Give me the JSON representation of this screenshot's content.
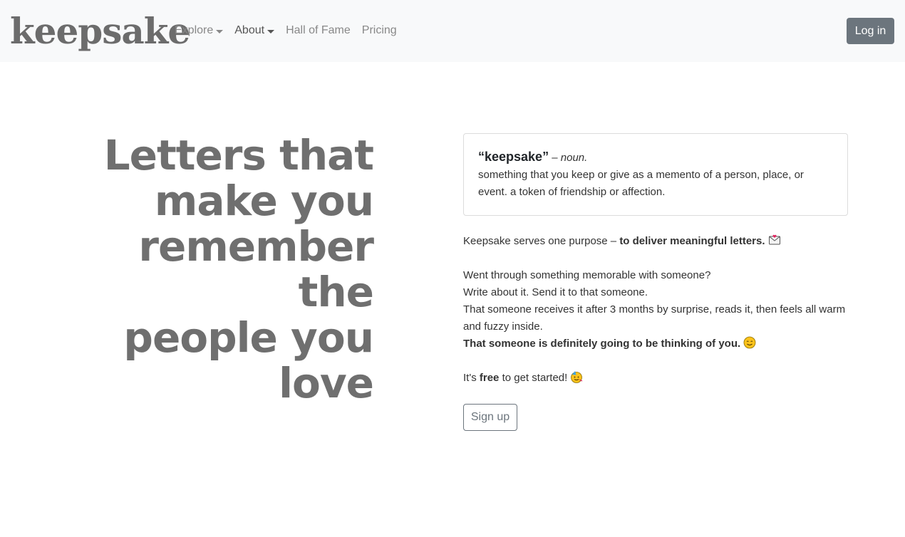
{
  "navbar": {
    "brand": "keepsake",
    "links": [
      {
        "label": "Explore"
      },
      {
        "label": "About"
      },
      {
        "label": "Hall of Fame"
      },
      {
        "label": "Pricing"
      }
    ],
    "login_label": "Log in"
  },
  "hero": {
    "lines": [
      "Letters that",
      "make you",
      "remember the",
      "people you",
      "love"
    ]
  },
  "definition": {
    "word": "“keepsake”",
    "dash": " – ",
    "part_of_speech": "noun.",
    "text": "something that you keep or give as a memento of a person, place, or event. a token of friendship or affection."
  },
  "body": {
    "purpose_prefix": "Keepsake serves one purpose – ",
    "purpose_bold": "to deliver meaningful letters.",
    "line1": "Went through something memorable with someone?",
    "line2": "Write about it. Send it to that someone.",
    "line3": "That someone receives it after 3 months by surprise, reads it, then feels all warm and fuzzy inside.",
    "line4_bold": "That someone is definitely going to be thinking of you.",
    "free_prefix": "It's ",
    "free_bold": "free",
    "free_suffix": " to get started!"
  },
  "icons": {
    "letter": "love-letter-icon",
    "smile": "smiling-face-icon",
    "party": "partying-face-icon"
  },
  "signup_label": "Sign up"
}
